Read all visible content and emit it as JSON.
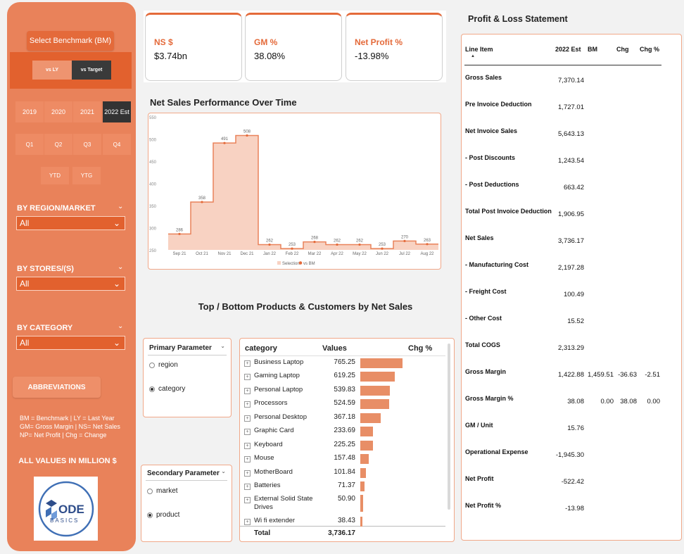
{
  "sidebar": {
    "benchmark_button": "Select Benchmark (BM)",
    "toggles": [
      "vs LY",
      "vs Target"
    ],
    "years": [
      "2019",
      "2020",
      "2021",
      "2022 Est"
    ],
    "quarters": [
      "Q1",
      "Q2",
      "Q3",
      "Q4"
    ],
    "periods": [
      "YTD",
      "YTG"
    ],
    "filters": [
      {
        "label": "BY REGION/MARKET",
        "value": "All"
      },
      {
        "label": "BY STORES/(S)",
        "value": "All"
      },
      {
        "label": "BY CATEGORY",
        "value": "All"
      }
    ],
    "abbreviations_button": "ABBREVIATIONS",
    "abbreviations_lines": [
      "BM = Benchmark | LY = Last Year",
      "GM= Gross Margin | NS= Net Sales",
      "NP= Net Profit | Chg = Change"
    ],
    "all_values_note": "ALL VALUES IN MILLION $",
    "logo_top": "ODE",
    "logo_bottom": "BASICS"
  },
  "kpis": [
    {
      "title": "NS $",
      "value": "$3.74bn"
    },
    {
      "title": "GM %",
      "value": "38.08%"
    },
    {
      "title": "Net Profit %",
      "value": "-13.98%"
    }
  ],
  "chart_title": "Net Sales Performance Over Time",
  "chart_data": {
    "type": "area",
    "x": [
      "Sep 21",
      "Oct 21",
      "Nov 21",
      "Dec 21",
      "Jan 22",
      "Feb 22",
      "Mar 22",
      "Apr 22",
      "May 22",
      "Jun 22",
      "Jul 22",
      "Aug 22"
    ],
    "series": [
      {
        "name": "Selection",
        "values": [
          286,
          358,
          491,
          508,
          262,
          253,
          268,
          262,
          262,
          253,
          270,
          263
        ]
      },
      {
        "name": "vs BM",
        "values": [
          286,
          358,
          491,
          508,
          262,
          253,
          268,
          262,
          262,
          253,
          270,
          263
        ]
      }
    ],
    "yticks": [
      250,
      300,
      350,
      400,
      450,
      500,
      550
    ],
    "ylim": [
      250,
      550
    ],
    "legend": "bottom",
    "colors": {
      "area": "#f8d2c2",
      "line": "#e9825a"
    }
  },
  "section_title": "Top / Bottom Products & Customers by Net Sales",
  "primary_param": {
    "title": "Primary Parameter",
    "options": [
      "region",
      "category"
    ],
    "selected": "category"
  },
  "secondary_param": {
    "title": "Secondary Parameter",
    "options": [
      "market",
      "product"
    ],
    "selected": "product"
  },
  "category_table": {
    "headers": [
      "category",
      "Values",
      "Chg %"
    ],
    "rows": [
      {
        "name": "Business Laptop",
        "value": 765.25
      },
      {
        "name": "Gaming Laptop",
        "value": 619.25
      },
      {
        "name": "Personal Laptop",
        "value": 539.83
      },
      {
        "name": "Processors",
        "value": 524.59
      },
      {
        "name": "Personal Desktop",
        "value": 367.18
      },
      {
        "name": "Graphic Card",
        "value": 233.69
      },
      {
        "name": "Keyboard",
        "value": 225.25
      },
      {
        "name": "Mouse",
        "value": 157.48
      },
      {
        "name": "MotherBoard",
        "value": 101.84
      },
      {
        "name": "Batteries",
        "value": 71.37
      },
      {
        "name": "External Solid State Drives",
        "value": 50.9
      },
      {
        "name": "Wi fi extender",
        "value": 38.43
      }
    ],
    "total_label": "Total",
    "total_value": "3,736.17"
  },
  "pl": {
    "title": "Profit & Loss Statement",
    "headers": [
      "Line Item",
      "2022 Est",
      "BM",
      "Chg",
      "Chg %"
    ],
    "rows": [
      {
        "label": "Gross Sales",
        "est": "7,370.14",
        "bm": "",
        "chg": "",
        "chgp": ""
      },
      {
        "label": "Pre Invoice Deduction",
        "est": "1,727.01",
        "bm": "",
        "chg": "",
        "chgp": ""
      },
      {
        "label": "Net Invoice Sales",
        "est": "5,643.13",
        "bm": "",
        "chg": "",
        "chgp": ""
      },
      {
        "label": "- Post Discounts",
        "est": "1,243.54",
        "bm": "",
        "chg": "",
        "chgp": ""
      },
      {
        "label": "- Post Deductions",
        "est": "663.42",
        "bm": "",
        "chg": "",
        "chgp": ""
      },
      {
        "label": "Total Post Invoice Deduction",
        "est": "1,906.95",
        "bm": "",
        "chg": "",
        "chgp": ""
      },
      {
        "label": "Net Sales",
        "est": "3,736.17",
        "bm": "",
        "chg": "",
        "chgp": ""
      },
      {
        "label": "- Manufacturing Cost",
        "est": "2,197.28",
        "bm": "",
        "chg": "",
        "chgp": ""
      },
      {
        "label": "- Freight Cost",
        "est": "100.49",
        "bm": "",
        "chg": "",
        "chgp": ""
      },
      {
        "label": "- Other Cost",
        "est": "15.52",
        "bm": "",
        "chg": "",
        "chgp": ""
      },
      {
        "label": "Total COGS",
        "est": "2,313.29",
        "bm": "",
        "chg": "",
        "chgp": ""
      },
      {
        "label": "Gross Margin",
        "est": "1,422.88",
        "bm": "1,459.51",
        "chg": "-36.63",
        "chgp": "-2.51"
      },
      {
        "label": "Gross Margin %",
        "est": "38.08",
        "bm": "0.00",
        "chg": "38.08",
        "chgp": "0.00"
      },
      {
        "label": "GM / Unit",
        "est": "15.76",
        "bm": "",
        "chg": "",
        "chgp": ""
      },
      {
        "label": "Operational Expense",
        "est": "-1,945.30",
        "bm": "",
        "chg": "",
        "chgp": ""
      },
      {
        "label": "Net Profit",
        "est": "-522.42",
        "bm": "",
        "chg": "",
        "chgp": ""
      },
      {
        "label": "Net Profit %",
        "est": "-13.98",
        "bm": "",
        "chg": "",
        "chgp": ""
      }
    ]
  }
}
